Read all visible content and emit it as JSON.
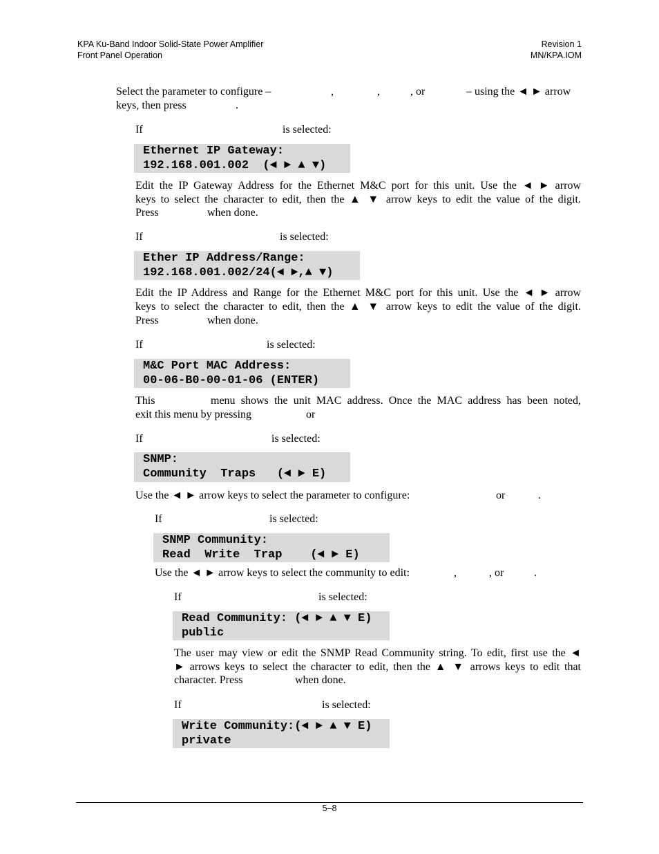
{
  "header": {
    "title": "KPA Ku-Band Indoor Solid-State Power Amplifier",
    "section": "Front Panel Operation",
    "revision": "Revision 1",
    "doc_number": "MN/KPA.IOM"
  },
  "intro": {
    "l1": [
      "Select the parameter to configure –",
      ",",
      ",",
      ", or",
      "– using the ◄ ► arrow"
    ],
    "l2": [
      "keys, then press",
      "."
    ]
  },
  "gateway": {
    "if": [
      "If",
      "is selected:"
    ],
    "lcd": [
      "Ethernet IP Gateway:",
      "192.168.001.002  (◄ ► ▲ ▼)"
    ],
    "p": [
      "Edit the IP Gateway Address for the Ethernet M&C port for this unit. Use the ◄ ► arrow",
      "keys to select the character to edit, then the ▲ ▼ arrow keys to edit the value of the digit.",
      "Press",
      "when done."
    ]
  },
  "address": {
    "if": [
      "If",
      "is selected:"
    ],
    "lcd": [
      "Ether IP Address/Range:",
      "192.168.001.002/24(◄ ►,▲ ▼)"
    ],
    "p": [
      "Edit the IP Address and Range for the Ethernet M&C port for this unit. Use the ◄ ► arrow",
      "keys to select the character to edit, then the ▲ ▼ arrow keys to edit the value of the digit.",
      "Press",
      "when done."
    ]
  },
  "mac": {
    "if": [
      "If",
      "is selected:"
    ],
    "lcd": [
      "M&C Port MAC Address:",
      "00-06-B0-00-01-06 (ENTER)"
    ],
    "p": [
      "This",
      "menu shows the unit MAC address. Once the MAC address has been noted,",
      "exit this menu by pressing",
      "or"
    ]
  },
  "snmp": {
    "if": [
      "If",
      "is selected:"
    ],
    "lcd": [
      "SNMP:",
      "Community  Traps   (◄ ► E)"
    ],
    "p": [
      "Use the ◄ ► arrow keys to select the parameter to configure:",
      "or",
      "."
    ]
  },
  "community": {
    "if": [
      "If",
      "is selected:"
    ],
    "lcd": [
      "SNMP Community:",
      "Read  Write  Trap    (◄ ► E)"
    ],
    "p": [
      "Use the ◄  ► arrow keys to select the community to edit:",
      ",",
      ", or",
      "."
    ]
  },
  "read": {
    "if": [
      "If",
      "is selected:"
    ],
    "lcd": [
      "Read Community: (◄ ► ▲ ▼ E)",
      "public"
    ],
    "p": [
      "The user may view or edit the SNMP Read Community string. To edit, first use the ◄",
      "► arrows keys to select the character to edit, then the ▲ ▼ arrows keys to edit that",
      "character. Press",
      "when done."
    ]
  },
  "write": {
    "if": [
      "If",
      "is selected:"
    ],
    "lcd": [
      "Write Community:(◄ ► ▲ ▼ E)",
      "private"
    ]
  },
  "footer": {
    "page": "5–8"
  }
}
